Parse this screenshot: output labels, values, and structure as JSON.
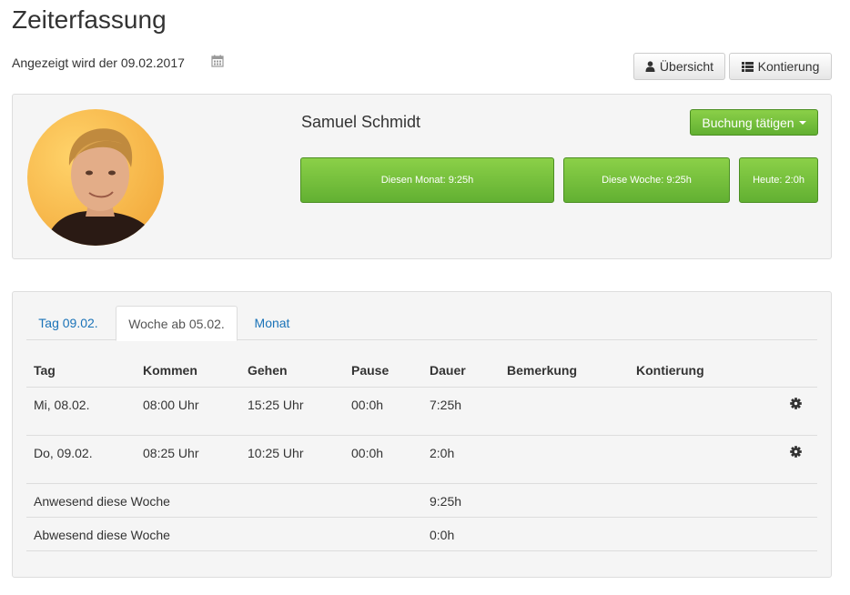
{
  "page": {
    "title": "Zeiterfassung",
    "date_line": "Angezeigt wird der 09.02.2017"
  },
  "toolbar": {
    "uebersicht_label": "Übersicht",
    "kontierung_label": "Kontierung"
  },
  "profile": {
    "name": "Samuel Schmidt",
    "buchung_label": "Buchung tätigen",
    "stats": {
      "monat": "Diesen Monat: 9:25h",
      "woche": "Diese Woche: 9:25h",
      "heute": "Heute: 2:0h"
    }
  },
  "tabs": [
    {
      "label": "Tag 09.02."
    },
    {
      "label": "Woche ab 05.02."
    },
    {
      "label": "Monat"
    }
  ],
  "table": {
    "headers": [
      "Tag",
      "Kommen",
      "Gehen",
      "Pause",
      "Dauer",
      "Bemerkung",
      "Kontierung"
    ],
    "rows": [
      {
        "tag": "Mi, 08.02.",
        "kommen": "08:00 Uhr",
        "gehen": "15:25 Uhr",
        "pause": "00:0h",
        "dauer": "7:25h",
        "bemerkung": "",
        "kontierung": ""
      },
      {
        "tag": "Do, 09.02.",
        "kommen": "08:25 Uhr",
        "gehen": "10:25 Uhr",
        "pause": "00:0h",
        "dauer": "2:0h",
        "bemerkung": "",
        "kontierung": ""
      }
    ],
    "summary": [
      {
        "label": "Anwesend diese Woche",
        "value": "9:25h"
      },
      {
        "label": "Abwesend diese Woche",
        "value": "0:0h"
      }
    ]
  },
  "colors": {
    "accent_green": "#62b032",
    "link_blue": "#1a73b8"
  },
  "icons": {
    "calendar": "calendar-icon",
    "user": "user-icon",
    "list": "list-icon",
    "gear": "gear-icon"
  }
}
